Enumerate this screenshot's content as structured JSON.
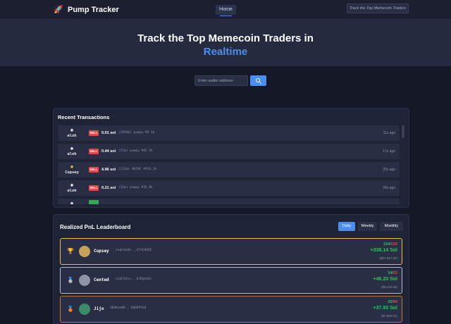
{
  "app": {
    "name": "Pump Tracker"
  },
  "nav": {
    "home_label": "Home",
    "search_placeholder": "Track the Top Memecoin Traders"
  },
  "hero": {
    "line1": "Track the Top Memecoin Traders in",
    "line2": "Realtime"
  },
  "wallet_search": {
    "placeholder": "Enter wallet address"
  },
  "recent_transactions": {
    "title": "Recent Transactions",
    "rows": [
      {
        "trader": "aloh",
        "type": "SELL",
        "amount": "0.01 sol",
        "details": "(3858k) pumpy ¥9.1k",
        "time": "11s ago"
      },
      {
        "trader": "aloh",
        "type": "SELL",
        "amount": "0.44 sol",
        "details": "(57m) pumpy ¥85.5k",
        "time": "17s ago"
      },
      {
        "trader": "Cupsey",
        "type": "SELL",
        "amount": "4.96 sol",
        "details": "(114m) ADYNC ¥916.1k",
        "time": "25s ago"
      },
      {
        "trader": "aloh",
        "type": "SELL",
        "amount": "0.21 sol",
        "details": "(32m) pumpy ¥35.9k",
        "time": "28s ago"
      },
      {
        "trader": "aloh",
        "type": "BUY",
        "amount": "",
        "details": "",
        "time": ""
      }
    ]
  },
  "leaderboard": {
    "title": "Realized PnL Leaderboard",
    "tabs": [
      "Daily",
      "Weekly",
      "Monthly"
    ],
    "active_tab": "Daily",
    "entries": [
      {
        "rank_icon": "trophy-icon",
        "name": "Cupsey",
        "address": "suqh3a4b...kTaCRQZE",
        "wins": "224",
        "losses": "133",
        "pnl": "+338.14 Sol",
        "usd": "($57,527.92)",
        "border": "#e7c23a"
      },
      {
        "rank_icon": "silver-medal-icon",
        "name": "Cented",
        "address": "CyaE1Vxv...DJRgeV4c",
        "wins": "34",
        "losses": "53",
        "pnl": "+46.20 Sol",
        "usd": "($9,240.08)",
        "border": "#b8bcd0"
      },
      {
        "rank_icon": "bronze-medal-icon",
        "name": "Jijo",
        "address": "4BdKaxN8...EW8DP5U4",
        "wins": "25",
        "losses": "94",
        "pnl": "+37.93 Sol",
        "usd": "($7,586.01)",
        "border": "#b87a3d"
      }
    ]
  },
  "colors": {
    "accent": "#4a8ef0",
    "sell": "#e04848",
    "buy": "#35a855",
    "gain": "#35c05a"
  }
}
